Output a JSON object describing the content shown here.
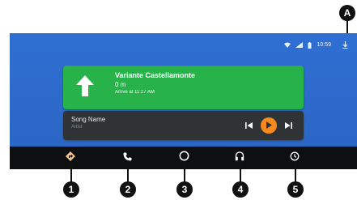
{
  "status_bar": {
    "time": "10:59"
  },
  "navigation": {
    "street": "Variante Castellamonte",
    "distance": "0 m",
    "eta": "Arrive at 11:27 AM",
    "direction_icon": "arrow-up-icon"
  },
  "media": {
    "song": "Song Name",
    "artist": "Artist",
    "accent_color": "#f68a1f"
  },
  "bottom_nav": {
    "items": [
      {
        "name": "navigation",
        "icon": "navigation-icon"
      },
      {
        "name": "phone",
        "icon": "phone-icon"
      },
      {
        "name": "home",
        "icon": "home-circle-icon"
      },
      {
        "name": "audio",
        "icon": "headphones-icon"
      },
      {
        "name": "recent",
        "icon": "recent-clock-icon"
      }
    ]
  },
  "callouts": {
    "a": "A",
    "n1": "1",
    "n2": "2",
    "n3": "3",
    "n4": "4",
    "n5": "5"
  },
  "colors": {
    "screen_bg": "#2b67c7",
    "nav_card": "#27b24a",
    "media_card": "#2f3336",
    "bottom_bar": "#0e0f10"
  }
}
